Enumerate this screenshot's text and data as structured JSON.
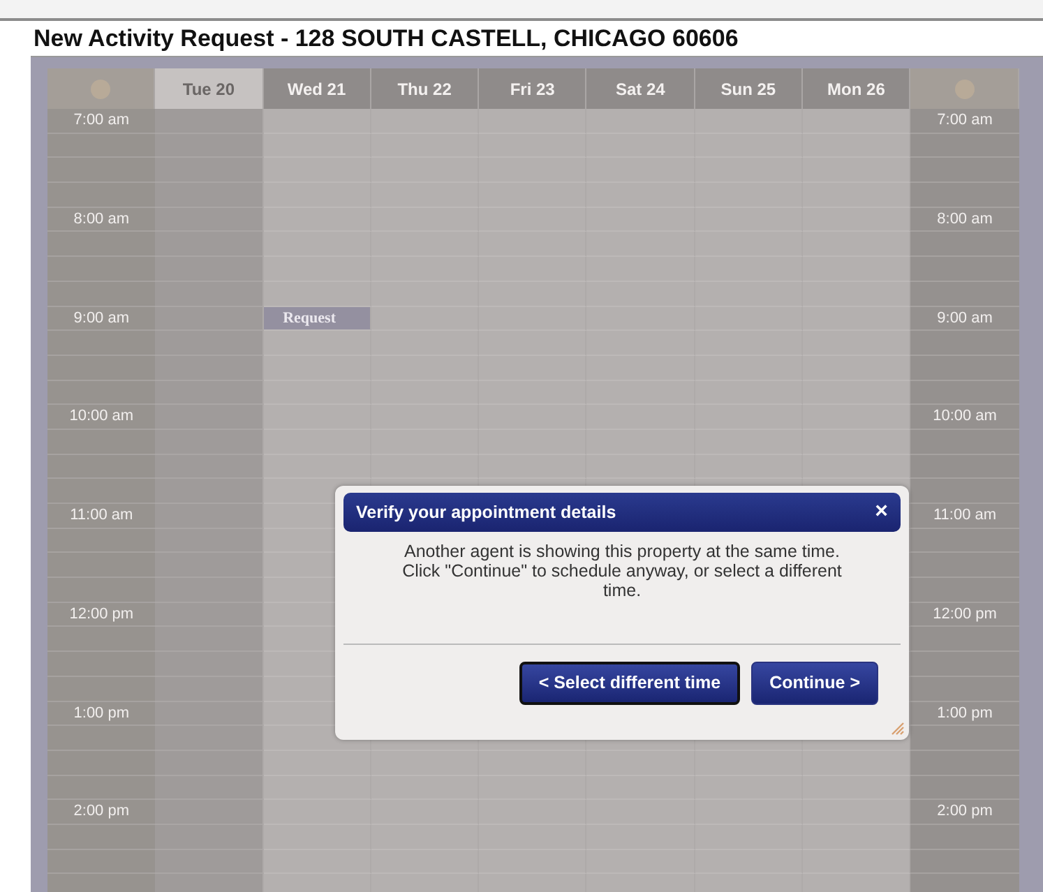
{
  "page": {
    "title": "New Activity Request - 128 SOUTH CASTELL, CHICAGO 60606"
  },
  "calendar": {
    "days": [
      {
        "label": "Tue 20",
        "selected": true
      },
      {
        "label": "Wed 21",
        "selected": false
      },
      {
        "label": "Thu 22",
        "selected": false
      },
      {
        "label": "Fri 23",
        "selected": false
      },
      {
        "label": "Sat 24",
        "selected": false
      },
      {
        "label": "Sun 25",
        "selected": false
      },
      {
        "label": "Mon 26",
        "selected": false
      }
    ],
    "hours": [
      {
        "label": "7:00 am",
        "label_right": "7:00 am"
      },
      {
        "label": "8:00 am",
        "label_right": "8:00 am"
      },
      {
        "label": "9:00 am",
        "label_right": "9:00 am",
        "cells": [
          {
            "kind": "empty"
          },
          {
            "kind": "event",
            "label": "Request"
          },
          {
            "kind": "empty"
          },
          {
            "kind": "empty"
          },
          {
            "kind": "empty"
          },
          {
            "kind": "empty"
          },
          {
            "kind": "empty"
          }
        ]
      },
      {
        "label": "10:00 am",
        "label_right": "10:00 am"
      },
      {
        "label": "11:00 am",
        "label_right": "11:00 am"
      },
      {
        "label": "12:00 pm",
        "label_right": "12:00 pm"
      },
      {
        "label": "1:00 pm",
        "label_right": "1:00 pm"
      },
      {
        "label": "2:00 pm",
        "label_right": "2:00 pm"
      }
    ]
  },
  "dialog": {
    "title": "Verify your appointment details",
    "close": "×",
    "message": "Another agent is showing this property at the same time. Click \"Continue\" to schedule anyway, or select a different time.",
    "buttons": [
      {
        "label": "< Select different time",
        "focused": true
      },
      {
        "label": "Continue >",
        "focused": false
      }
    ]
  }
}
